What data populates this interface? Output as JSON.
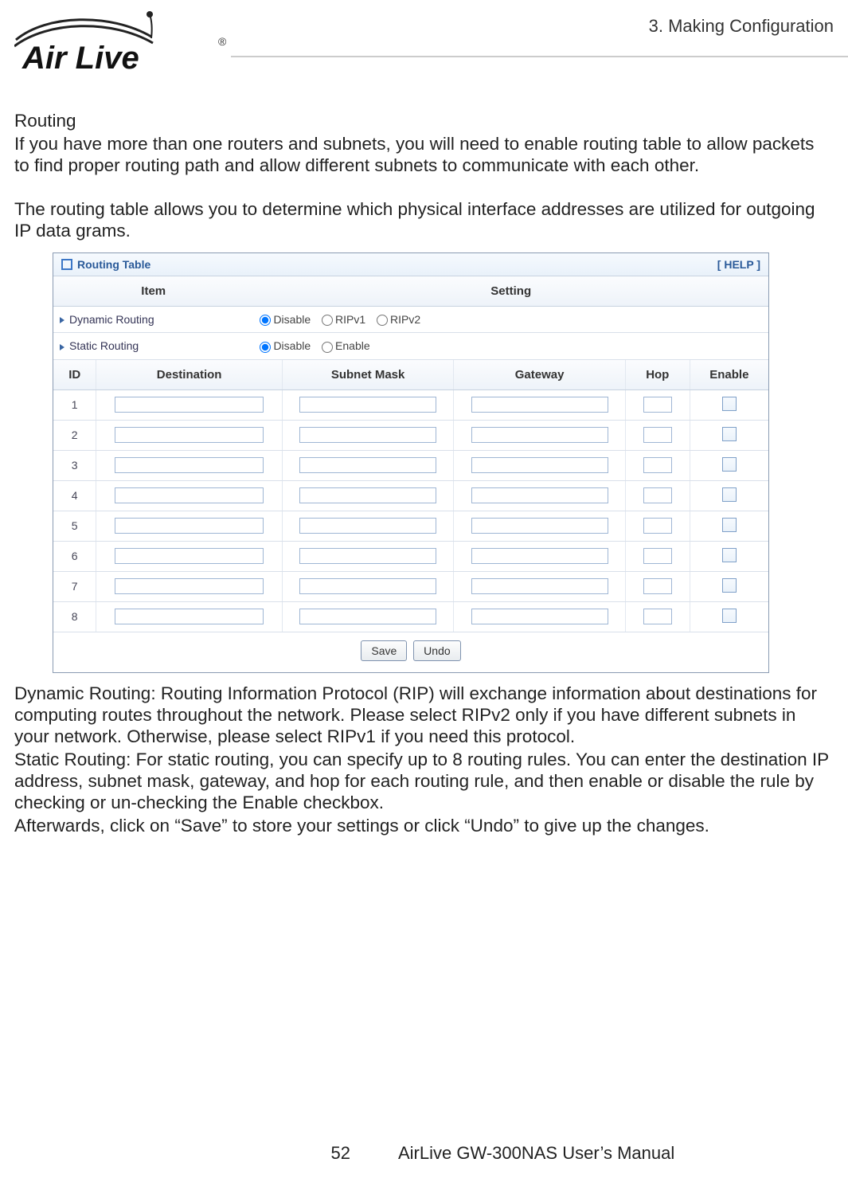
{
  "header": {
    "section_label": "3.  Making  Configuration",
    "logo_text": "Air Live",
    "registered": "®"
  },
  "intro": {
    "h": "Routing",
    "p1": "If you have more than one routers and subnets, you will need to enable routing table to allow packets to find proper routing path and allow different subnets to communicate with each other.",
    "p2": "The routing table allows you to determine which physical interface addresses are utilized for outgoing IP data grams."
  },
  "panel": {
    "title": "Routing Table",
    "help": "[ HELP ]",
    "col_item": "Item",
    "col_setting": "Setting",
    "dynamic_label": "Dynamic Routing",
    "static_label": "Static Routing",
    "radio_disable": "Disable",
    "radio_ripv1": "RIPv1",
    "radio_ripv2": "RIPv2",
    "radio_enable": "Enable",
    "route_cols": {
      "id": "ID",
      "dest": "Destination",
      "mask": "Subnet Mask",
      "gw": "Gateway",
      "hop": "Hop",
      "enable": "Enable"
    },
    "rows": [
      "1",
      "2",
      "3",
      "4",
      "5",
      "6",
      "7",
      "8"
    ],
    "btn_save": "Save",
    "btn_undo": "Undo"
  },
  "outro": {
    "p1": "Dynamic Routing: Routing Information Protocol (RIP) will exchange information about destinations for computing routes throughout the network. Please select RIPv2 only if you have different subnets in your network. Otherwise, please select RIPv1 if you need this protocol.",
    "p2": "Static Routing: For static routing, you can specify up to 8 routing rules. You can enter the destination IP address, subnet mask, gateway, and hop for each routing rule, and then enable or disable the rule by checking or un-checking the Enable checkbox.",
    "p3": "Afterwards, click on “Save” to store your settings or click “Undo” to give up the changes."
  },
  "footer": {
    "page": "52",
    "manual": "AirLive GW-300NAS User’s Manual"
  }
}
